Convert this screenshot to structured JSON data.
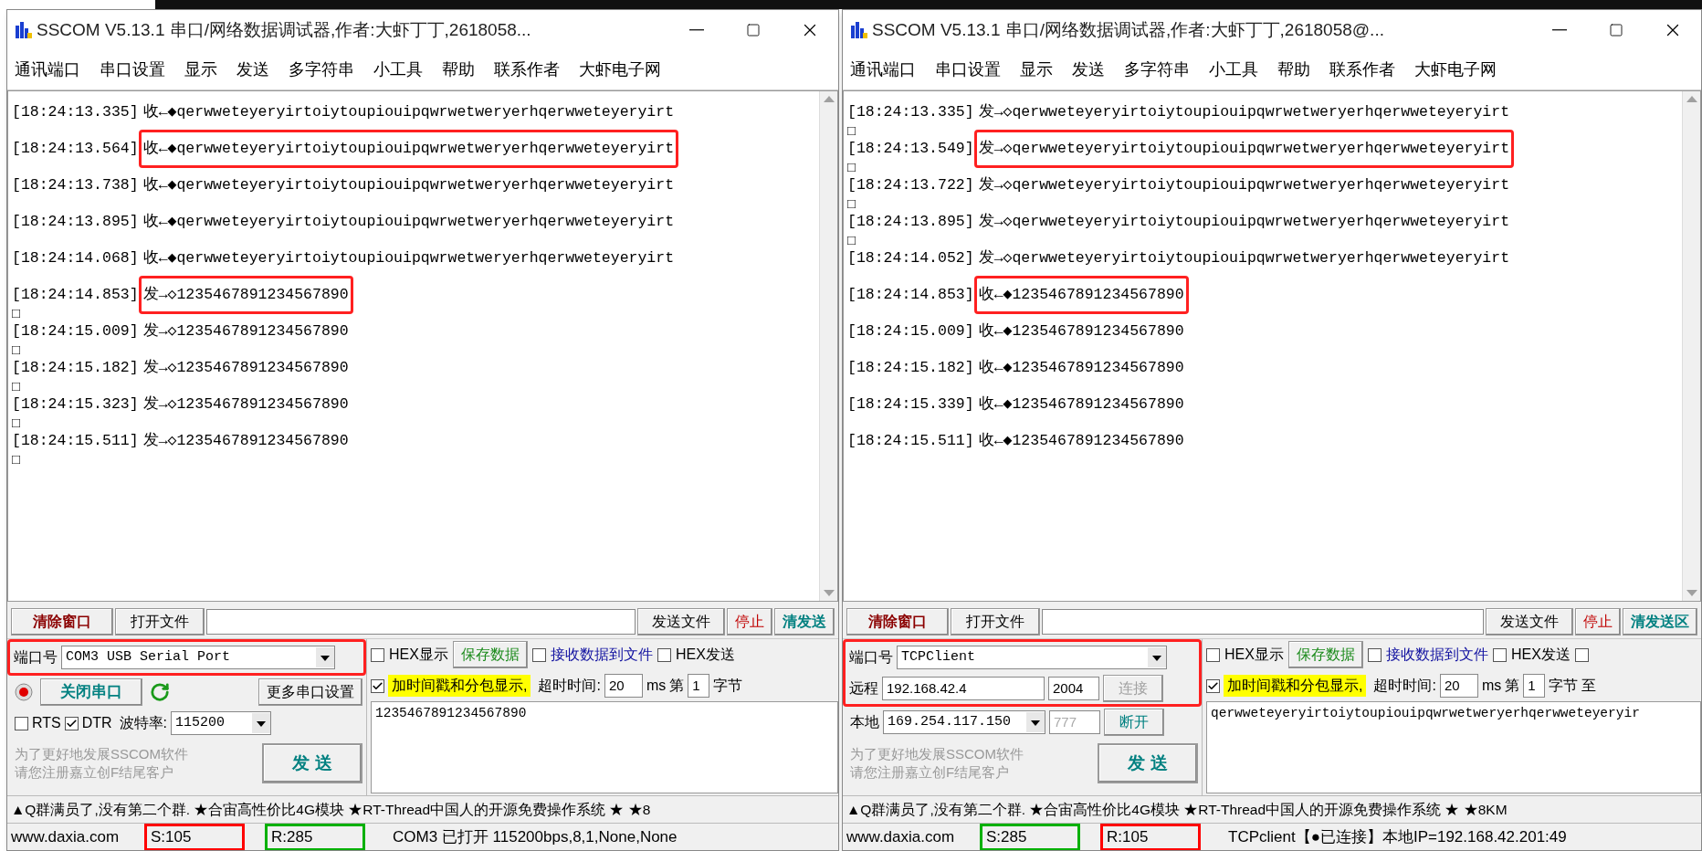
{
  "windows": [
    {
      "kind": "serial",
      "title": "SSCOM V5.13.1 串口/网络数据调试器,作者:大虾丁丁,2618058...",
      "menu": [
        "通讯端口",
        "串口设置",
        "显示",
        "发送",
        "多字符串",
        "小工具",
        "帮助",
        "联系作者",
        "大虾电子网"
      ],
      "log": [
        {
          "time": "[18:24:13.335]",
          "direction": "收←◆",
          "data": "qerwweteyeryirtoiytoupiouipqwrwetweryerhqerwweteyeryirt",
          "highlighted": false
        },
        {
          "time": "[18:24:13.564]",
          "direction": "收←◆",
          "data": "qerwweteyeryirtoiytoupiouipqwrwetweryerhqerwweteyeryirt",
          "highlighted": true
        },
        {
          "time": "[18:24:13.738]",
          "direction": "收←◆",
          "data": "qerwweteyeryirtoiytoupiouipqwrwetweryerhqerwweteyeryirt",
          "highlighted": false
        },
        {
          "time": "[18:24:13.895]",
          "direction": "收←◆",
          "data": "qerwweteyeryirtoiytoupiouipqwrwetweryerhqerwweteyeryirt",
          "highlighted": false
        },
        {
          "time": "[18:24:14.068]",
          "direction": "收←◆",
          "data": "qerwweteyeryirtoiytoupiouipqwrwetweryerhqerwweteyeryirt",
          "highlighted": false
        },
        {
          "time": "[18:24:14.853]",
          "direction": "发→◇",
          "data": "1235467891234567890",
          "highlighted": true,
          "continuation": "□"
        },
        {
          "time": "[18:24:15.009]",
          "direction": "发→◇",
          "data": "1235467891234567890",
          "highlighted": false,
          "continuation": "□"
        },
        {
          "time": "[18:24:15.182]",
          "direction": "发→◇",
          "data": "1235467891234567890",
          "highlighted": false,
          "continuation": "□"
        },
        {
          "time": "[18:24:15.323]",
          "direction": "发→◇",
          "data": "1235467891234567890",
          "highlighted": false,
          "continuation": "□"
        },
        {
          "time": "[18:24:15.511]",
          "direction": "发→◇",
          "data": "1235467891234567890",
          "highlighted": false,
          "continuation": "□"
        }
      ],
      "toolbar": {
        "clear": "清除窗口",
        "open_file": "打开文件",
        "send_file": "发送文件",
        "stop": "停止",
        "clear_send": "清发送"
      },
      "config": {
        "highlighted": true,
        "port_label": "端口号",
        "port": "COM3 USB Serial Port",
        "open_button": "关闭串口",
        "more": "更多串口设置",
        "rts": {
          "label": "RTS",
          "checked": false
        },
        "dtr": {
          "label": "DTR",
          "checked": true
        },
        "baud_label": "波特率:",
        "baud": "115200"
      },
      "promo": [
        "为了更好地发展SSCOM软件",
        "请您注册嘉立创F结尾客户"
      ],
      "send": "发 送",
      "options": {
        "hex_display": {
          "label": "HEX显示",
          "checked": false
        },
        "save": "保存数据",
        "recv_file": {
          "label": "接收数据到文件",
          "checked": false
        },
        "hex_send": {
          "label": "HEX发送",
          "checked": false
        },
        "timestamp": {
          "label": "加时间戳和分包显示,",
          "checked": true
        },
        "timeout_label": "超时时间:",
        "timeout": "20",
        "ms": "ms",
        "from_label": "第",
        "from": "1",
        "bytes_label": "字节"
      },
      "send_text": "1235467891234567890",
      "marquee": "▲Q群满员了,没有第二个群. ★合宙高性价比4G模块 ★RT-Thread中国人的开源免费操作系统 ★ ★8",
      "status": {
        "site": "www.daxia.com",
        "counters": [
          {
            "text": "S:105",
            "color": "#ff0000"
          },
          {
            "text": "R:285",
            "color": "#00b000"
          }
        ],
        "info": "COM3 已打开  115200bps,8,1,None,None"
      }
    },
    {
      "kind": "tcp",
      "title": "SSCOM V5.13.1 串口/网络数据调试器,作者:大虾丁丁,2618058@...",
      "menu": [
        "通讯端口",
        "串口设置",
        "显示",
        "发送",
        "多字符串",
        "小工具",
        "帮助",
        "联系作者",
        "大虾电子网"
      ],
      "log": [
        {
          "time": "[18:24:13.335]",
          "direction": "发→◇",
          "data": "qerwweteyeryirtoiytoupiouipqwrwetweryerhqerwweteyeryirt",
          "highlighted": false,
          "continuation": "□"
        },
        {
          "time": "[18:24:13.549]",
          "direction": "发→◇",
          "data": "qerwweteyeryirtoiytoupiouipqwrwetweryerhqerwweteyeryirt",
          "highlighted": true,
          "continuation": "□"
        },
        {
          "time": "[18:24:13.722]",
          "direction": "发→◇",
          "data": "qerwweteyeryirtoiytoupiouipqwrwetweryerhqerwweteyeryirt",
          "highlighted": false,
          "continuation": "□"
        },
        {
          "time": "[18:24:13.895]",
          "direction": "发→◇",
          "data": "qerwweteyeryirtoiytoupiouipqwrwetweryerhqerwweteyeryirt",
          "highlighted": false,
          "continuation": "□"
        },
        {
          "time": "[18:24:14.052]",
          "direction": "发→◇",
          "data": "qerwweteyeryirtoiytoupiouipqwrwetweryerhqerwweteyeryirt",
          "highlighted": false
        },
        {
          "time": "[18:24:14.853]",
          "direction": "收←◆",
          "data": "1235467891234567890",
          "highlighted": true
        },
        {
          "time": "[18:24:15.009]",
          "direction": "收←◆",
          "data": "1235467891234567890",
          "highlighted": false
        },
        {
          "time": "[18:24:15.182]",
          "direction": "收←◆",
          "data": "1235467891234567890",
          "highlighted": false
        },
        {
          "time": "[18:24:15.339]",
          "direction": "收←◆",
          "data": "1235467891234567890",
          "highlighted": false
        },
        {
          "time": "[18:24:15.511]",
          "direction": "收←◆",
          "data": "1235467891234567890",
          "highlighted": false
        }
      ],
      "toolbar": {
        "clear": "清除窗口",
        "open_file": "打开文件",
        "send_file": "发送文件",
        "stop": "停止",
        "clear_send": "清发送区"
      },
      "config": {
        "highlighted": true,
        "port_label": "端口号",
        "port": "TCPClient",
        "remote_label": "远程",
        "remote_ip": "192.168.42.4",
        "remote_port": "2004",
        "connect": {
          "label": "连接",
          "disabled": true
        },
        "local_label": "本地",
        "local_ip": "169.254.117.150",
        "local_port": {
          "value": "777",
          "disabled": true
        },
        "disconnect": "断开"
      },
      "promo": [
        "为了更好地发展SSCOM软件",
        "请您注册嘉立创F结尾客户"
      ],
      "send": "发 送",
      "options": {
        "hex_display": {
          "label": "HEX显示",
          "checked": false
        },
        "save": "保存数据",
        "recv_file": {
          "label": "接收数据到文件",
          "checked": false
        },
        "hex_send": {
          "label": "HEX发送",
          "checked": false
        },
        "trailing_checkbox": {
          "checked": false
        },
        "timestamp": {
          "label": "加时间戳和分包显示,",
          "checked": true
        },
        "timeout_label": "超时时间:",
        "timeout": "20",
        "ms": "ms",
        "from_label": "第",
        "from": "1",
        "bytes_label": "字节",
        "to_label": "至"
      },
      "send_text": "qerwweteyeryirtoiytoupiouipqwrwetweryerhqerwweteyeryir",
      "marquee": "▲Q群满员了,没有第二个群. ★合宙高性价比4G模块 ★RT-Thread中国人的开源免费操作系统 ★ ★8KM",
      "status": {
        "site": "www.daxia.com",
        "counters": [
          {
            "text": "S:285",
            "color": "#00b000"
          },
          {
            "text": "R:105",
            "color": "#ff0000"
          }
        ],
        "info": "TCPclient【●已连接】本地IP=192.168.42.201:49"
      }
    }
  ]
}
